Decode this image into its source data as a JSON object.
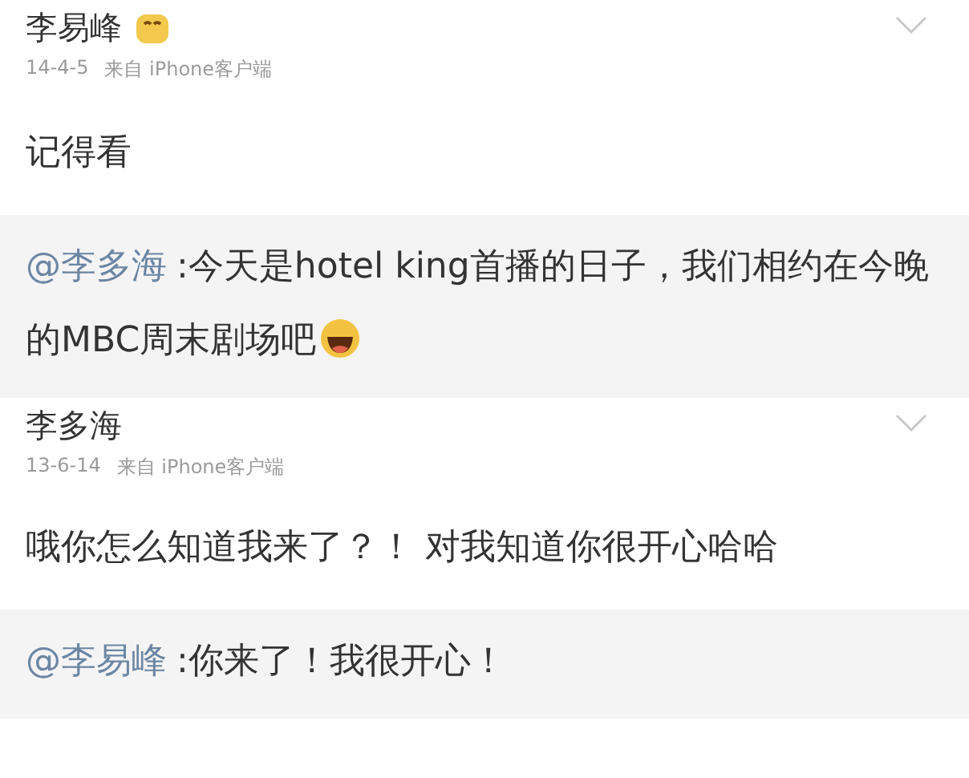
{
  "posts": [
    {
      "author": "李易峰",
      "badge": true,
      "date": "14-4-5",
      "source": "来自 iPhone客户端",
      "text": "记得看",
      "quote": {
        "mention": "@李多海",
        "text": ":今天是hotel king首播的日子，我们相约在今晚的MBC周末剧场吧",
        "emoji": true
      }
    },
    {
      "author": "李多海",
      "badge": false,
      "date": "13-6-14",
      "source": "来自 iPhone客户端",
      "text": "哦你怎么知道我来了？！ 对我知道你很开心哈哈",
      "quote": {
        "mention": "@李易峰",
        "text": ":你来了！我很开心！",
        "emoji": false
      }
    }
  ]
}
